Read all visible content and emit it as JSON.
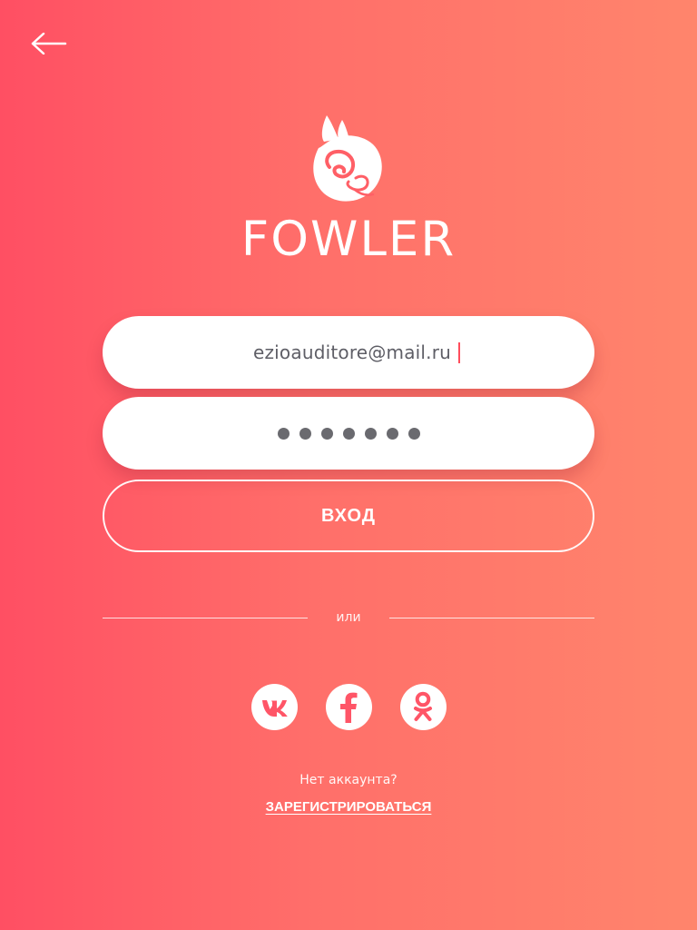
{
  "header": {
    "back_icon": "arrow-left-icon"
  },
  "logo": {
    "icon": "fox-logo-icon",
    "name": "FOWLER"
  },
  "form": {
    "email": "ezioauditore@mail.ru",
    "password_masked": "●●●●●●●",
    "login_label": "ВХОД"
  },
  "divider": {
    "label": "или"
  },
  "social": [
    {
      "name": "vk",
      "icon": "vk-icon"
    },
    {
      "name": "facebook",
      "icon": "facebook-icon"
    },
    {
      "name": "odnoklassniki",
      "icon": "odnoklassniki-icon"
    }
  ],
  "footer": {
    "no_account": "Нет аккаунта?",
    "register_label": "ЗАРЕГИСТРИРОВАТЬСЯ"
  },
  "colors": {
    "gradient_start": "#ff4f63",
    "gradient_end": "#ff856c",
    "field_text": "#5e5e66",
    "accent": "#ff4d5c"
  }
}
